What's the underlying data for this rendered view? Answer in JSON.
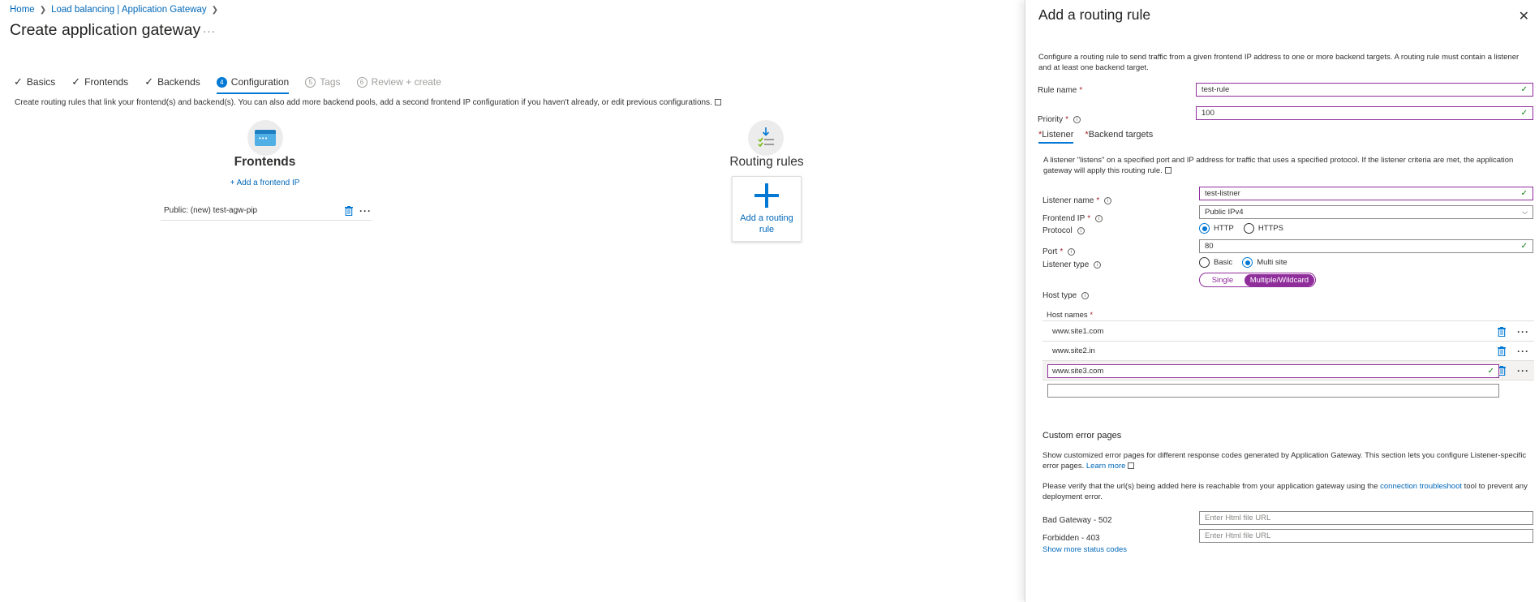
{
  "breadcrumb": [
    {
      "label": "Home"
    },
    {
      "label": "Load balancing | Application Gateway"
    }
  ],
  "page_title": "Create application gateway",
  "page_more": "···",
  "wizard_tabs": [
    {
      "label": "Basics",
      "state": "done"
    },
    {
      "label": "Frontends",
      "state": "done"
    },
    {
      "label": "Backends",
      "state": "done"
    },
    {
      "label": "Configuration",
      "number": "4",
      "state": "active"
    },
    {
      "label": "Tags",
      "number": "5",
      "state": "disabled"
    },
    {
      "label": "Review + create",
      "number": "6",
      "state": "disabled"
    }
  ],
  "intro_text": "Create routing rules that link your frontend(s) and backend(s). You can also add more backend pools, add a second frontend IP configuration if you haven't already, or edit previous configurations.",
  "frontends": {
    "heading": "Frontends",
    "add_label": "+ Add a frontend IP",
    "items": [
      {
        "label": "Public: (new) test-agw-pip"
      }
    ]
  },
  "routing": {
    "heading": "Routing rules",
    "add_label_line1": "Add a routing",
    "add_label_line2": "rule"
  },
  "blade": {
    "title": "Add a routing rule",
    "description": "Configure a routing rule to send traffic from a given frontend IP address to one or more backend targets. A routing rule must contain a listener and at least one backend target.",
    "rule_name": {
      "label": "Rule name",
      "value": "test-rule"
    },
    "priority": {
      "label": "Priority",
      "value": "100"
    },
    "tabs": [
      {
        "label": "Listener",
        "active": true
      },
      {
        "label": "Backend targets",
        "active": false
      }
    ],
    "listener_desc": "A listener \"listens\" on a specified port and IP address for traffic that uses a specified protocol. If the listener criteria are met, the application gateway will apply this routing rule.",
    "listener_name": {
      "label": "Listener name",
      "value": "test-listner"
    },
    "frontend_ip": {
      "label": "Frontend IP",
      "value": "Public IPv4"
    },
    "protocol": {
      "label": "Protocol",
      "options": [
        "HTTP",
        "HTTPS"
      ],
      "selected": "HTTP"
    },
    "port": {
      "label": "Port",
      "value": "80"
    },
    "listener_type": {
      "label": "Listener type",
      "options": [
        "Basic",
        "Multi site"
      ],
      "selected": "Multi site"
    },
    "host_type": {
      "label": "Host type",
      "options": [
        "Single",
        "Multiple/Wildcard"
      ],
      "selected": "Multiple/Wildcard"
    },
    "host_names": {
      "label": "Host names",
      "items": [
        "www.site1.com",
        "www.site2.in",
        "www.site3.com"
      ]
    },
    "custom_errors": {
      "title": "Custom error pages",
      "desc": "Show customized error pages for different response codes generated by Application Gateway. This section lets you configure Listener-specific error pages.",
      "learn_more": "Learn more",
      "verify_pre": "Please verify that the url(s) being added here is reachable from your application gateway using the",
      "verify_link": "connection troubleshoot",
      "verify_post": "tool to prevent any deployment error.",
      "bad_gateway": {
        "label": "Bad Gateway - 502",
        "placeholder": "Enter Html file URL"
      },
      "forbidden": {
        "label": "Forbidden - 403",
        "placeholder": "Enter Html file URL"
      },
      "show_more": "Show more status codes"
    }
  },
  "colors": {
    "accent": "#0078d4",
    "link": "#0067b8",
    "valid_border": "#8f2d9b",
    "required": "#a4262c",
    "ok": "#107c10"
  }
}
